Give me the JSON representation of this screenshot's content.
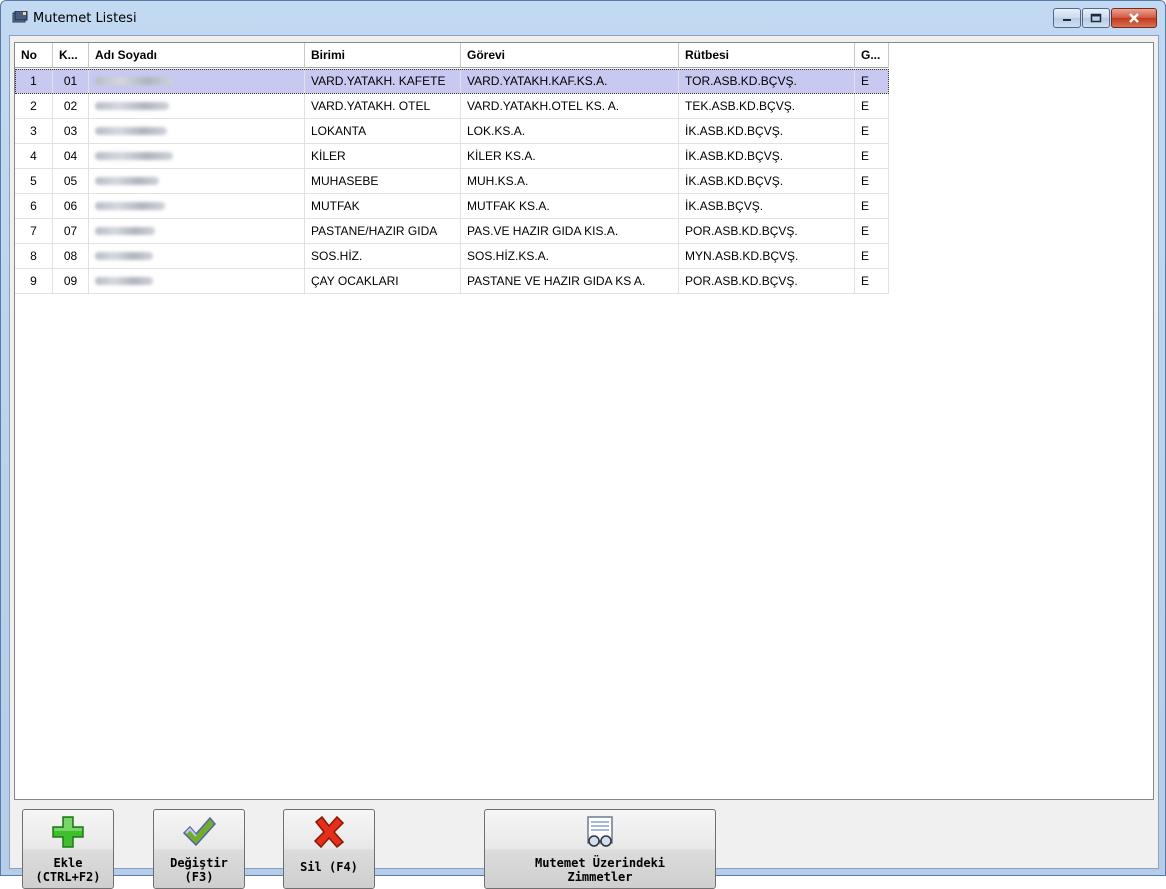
{
  "window": {
    "title": "Mutemet Listesi",
    "icons": {
      "app": "envelope-stamp-icon",
      "minimize": "minimize-icon",
      "maximize": "maximize-icon",
      "close": "close-icon"
    }
  },
  "grid": {
    "columns": [
      "No",
      "K...",
      "Adı Soyadı",
      "Birimi",
      "Görevi",
      "Rütbesi",
      "G..."
    ],
    "rows": [
      {
        "no": "1",
        "k": "01",
        "birimi": "VARD.YATAKH. KAFETE",
        "gorevi": "VARD.YATAKH.KAF.KS.A.",
        "rutbesi": "TOR.ASB.KD.BÇVŞ.",
        "g": "E",
        "selected": true
      },
      {
        "no": "2",
        "k": "02",
        "birimi": "VARD.YATAKH. OTEL",
        "gorevi": "VARD.YATAKH.OTEL KS. A.",
        "rutbesi": "TEK.ASB.KD.BÇVŞ.",
        "g": "E"
      },
      {
        "no": "3",
        "k": "03",
        "birimi": "LOKANTA",
        "gorevi": "LOK.KS.A.",
        "rutbesi": "İK.ASB.KD.BÇVŞ.",
        "g": "E"
      },
      {
        "no": "4",
        "k": "04",
        "birimi": "KİLER",
        "gorevi": "KİLER KS.A.",
        "rutbesi": "İK.ASB.KD.BÇVŞ.",
        "g": "E"
      },
      {
        "no": "5",
        "k": "05",
        "birimi": "MUHASEBE",
        "gorevi": "MUH.KS.A.",
        "rutbesi": "İK.ASB.KD.BÇVŞ.",
        "g": "E"
      },
      {
        "no": "6",
        "k": "06",
        "birimi": "MUTFAK",
        "gorevi": "MUTFAK KS.A.",
        "rutbesi": "İK.ASB.BÇVŞ.",
        "g": "E"
      },
      {
        "no": "7",
        "k": "07",
        "birimi": "PASTANE/HAZIR GIDA",
        "gorevi": "PAS.VE HAZIR GIDA KIS.A.",
        "rutbesi": "POR.ASB.KD.BÇVŞ.",
        "g": "E"
      },
      {
        "no": "8",
        "k": "08",
        "birimi": "SOS.HİZ.",
        "gorevi": "SOS.HİZ.KS.A.",
        "rutbesi": "MYN.ASB.KD.BÇVŞ.",
        "g": "E"
      },
      {
        "no": "9",
        "k": "09",
        "birimi": "ÇAY OCAKLARI",
        "gorevi": "PASTANE VE HAZIR GIDA KS A.",
        "rutbesi": "POR.ASB.KD.BÇVŞ.",
        "g": "E"
      }
    ]
  },
  "toolbar": {
    "ekle": {
      "line1": "Ekle",
      "line2": "(CTRL+F2)",
      "icon": "plus-icon"
    },
    "degistir": {
      "line1": "Değiştir",
      "line2": "(F3)",
      "icon": "checkmark-icon"
    },
    "sil": {
      "line1": "Sil (F4)",
      "icon": "x-mark-icon"
    },
    "zimmet": {
      "line1": "Mutemet Üzerindeki",
      "line2": "Zimmetler",
      "icon": "document-glasses-icon"
    }
  },
  "colors": {
    "selected_row": "#c8c8f0",
    "titlebar": "#c2d9f2",
    "plus": "#3fbf2f",
    "check": "#6fae2a",
    "xmark": "#e2301a"
  }
}
